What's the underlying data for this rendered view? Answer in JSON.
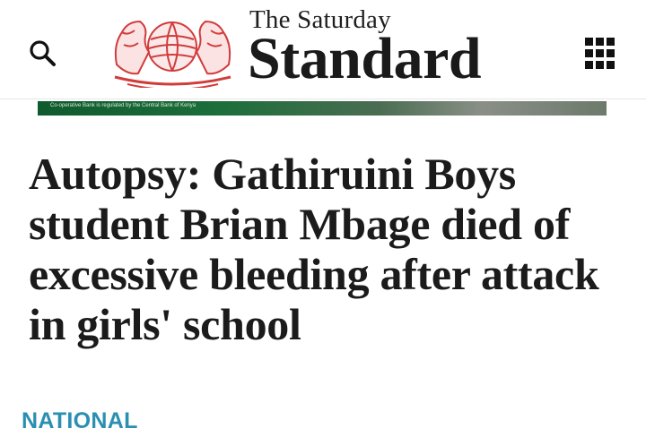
{
  "header": {
    "brand_top": "The Saturday",
    "brand_main": "Standard",
    "search_icon": "search-icon",
    "menu_icon": "grid-menu-icon",
    "crest_icon": "coat-of-arms-logo",
    "crest_color": "#d23b3b"
  },
  "ad": {
    "text": "Co-operative Bank is regulated by the Central Bank of Kenya"
  },
  "article": {
    "headline": "Autopsy: Gathiruini Boys student Brian Mbage died of excessive bleeding after attack in girls' school",
    "category": "NATIONAL",
    "category_color": "#2a8fb0"
  }
}
